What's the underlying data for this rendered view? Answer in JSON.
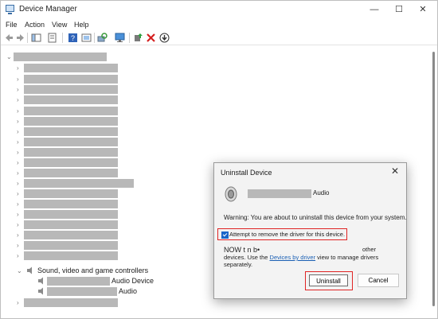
{
  "window": {
    "title": "Device Manager",
    "controls": {
      "minimize": "—",
      "maximize": "☐",
      "close": "✕"
    }
  },
  "menu": [
    "File",
    "Action",
    "View",
    "Help"
  ],
  "toolbar_icons": [
    "back-icon",
    "forward-icon",
    "show-hide-console-tree-icon",
    "properties-icon",
    "help-icon",
    "view-icon",
    "scan-hardware-icon",
    "monitor-icon",
    "update-driver-icon",
    "uninstall-device-icon",
    "disable-device-icon"
  ],
  "tree": {
    "sound_category": "Sound, video and game controllers",
    "sound_children": [
      "Audio Device",
      "Audio"
    ]
  },
  "dialog": {
    "title": "Uninstall Device",
    "device_name_suffix": "Audio",
    "warning": "Warning: You are about to uninstall this device from your system.",
    "checkbox_label": "Attempt to remove the driver for this device.",
    "checkbox_checked": true,
    "note_fragment": "NOW t n b•",
    "note_other": "other",
    "note_line2_prefix": "devices. Use the ",
    "note_link": "Devices by driver",
    "note_line2_suffix": " view to manage drivers",
    "note_line3": "separately.",
    "uninstall_label": "Uninstall",
    "cancel_label": "Cancel"
  },
  "colors": {
    "accent": "#1a66c9",
    "highlight_border": "#e02424",
    "redacted": "#b8b8b8"
  }
}
